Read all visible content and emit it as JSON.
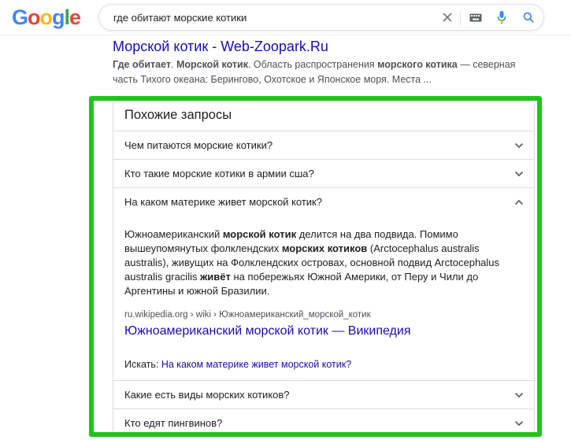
{
  "header": {
    "logo": [
      "G",
      "o",
      "o",
      "g",
      "l",
      "e"
    ],
    "logo_colors": [
      "#4285F4",
      "#EA4335",
      "#FBBC05",
      "#4285F4",
      "#34A853",
      "#EA4335"
    ],
    "query": "где обитают морские котики"
  },
  "result": {
    "title": "Морской котик - Web-Zoopark.Ru",
    "snippet_parts": {
      "p1": "Где обитает",
      "p2": ". ",
      "p3": "Морской котик",
      "p4": ". Область распространения ",
      "p5": "морского котика",
      "p6": " — северная часть Тихого океана: Берингово, Охотское и Японское моря. Места ..."
    }
  },
  "paa": {
    "title": "Похожие запросы",
    "questions": [
      "Чем питаются морские котики?",
      "Кто такие морские котики в армии сша?",
      "На каком материке живет морской котик?",
      "Какие есть виды морских котиков?",
      "Кто едят пингвинов?"
    ],
    "answer": {
      "a1": "Южноамериканский ",
      "a2": "морской котик",
      "a3": " делится на два подвида. Помимо вышеупомянутых фолклендских ",
      "a4": "морских котиков",
      "a5": " (Arctocephalus australis australis), живущих на Фолклендских островах, основной подвид Arctocephalus australis gracilis ",
      "a6": "живёт",
      "a7": " на побережьях Южной Америки, от Перу и Чили до Аргентины и южной Бразилии."
    },
    "source_url": "ru.wikipedia.org › wiki › Южноамериканский_морской_котик",
    "source_title": "Южноамериканский морской котик — Википедия",
    "search_label": "Искать: ",
    "search_link": "На каком материке живет морской котик?"
  },
  "colors": {
    "highlight_frame": "#22c21f",
    "link": "#1a0dab"
  }
}
